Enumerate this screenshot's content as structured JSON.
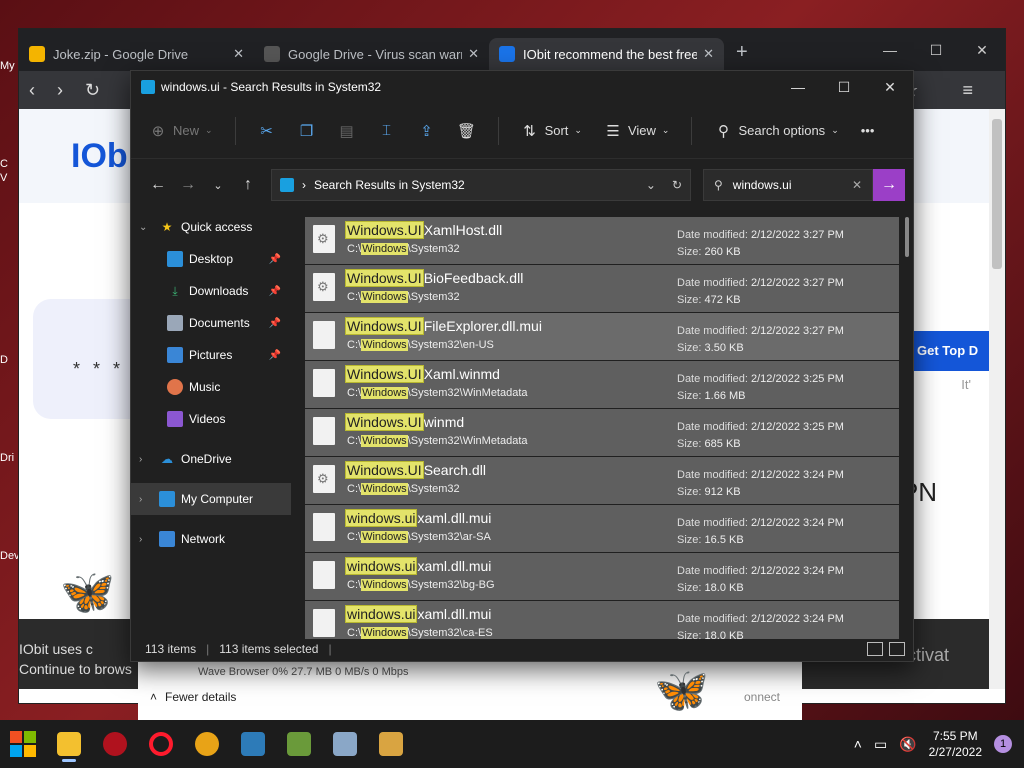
{
  "desktop": {
    "icon_labels": [
      "My",
      "C",
      "V",
      "D",
      "Dri",
      "Dev"
    ]
  },
  "browser": {
    "tabs": [
      {
        "label": "Joke.zip - Google Drive",
        "color": "#f4b400"
      },
      {
        "label": "Google Drive - Virus scan warn",
        "color": "#555555"
      },
      {
        "label": "IObit recommend the best free",
        "color": "#1a73e8"
      }
    ],
    "new_tab": "+",
    "page": {
      "logo": "IObit",
      "cta": "Get Top D",
      "its": "It'",
      "pn": "PN",
      "password_mask": "* * *",
      "cookie_line1": "IObit uses c",
      "cookie_line2": "Continue to brows",
      "watermark": "e activat"
    }
  },
  "taskmgr": {
    "row_text": "Wave Browser       0%     27.7 MB     0 MB/s     0 Mbps",
    "fewer_details": "Fewer details",
    "connect": "onnect"
  },
  "explorer": {
    "title": "windows.ui - Search Results in System32",
    "commands": {
      "new": "New",
      "sort": "Sort",
      "view": "View",
      "search_options": "Search options",
      "more": "•••"
    },
    "address": "Search Results in System32",
    "search_value": "windows.ui",
    "nav": {
      "quick_access": "Quick access",
      "desktop": "Desktop",
      "downloads": "Downloads",
      "documents": "Documents",
      "pictures": "Pictures",
      "music": "Music",
      "videos": "Videos",
      "onedrive": "OneDrive",
      "my_computer": "My Computer",
      "network": "Network"
    },
    "results": [
      {
        "match": "Windows.UI",
        "rest": "XamlHost.dll",
        "path_pre": "C:\\",
        "path_match": "Windows",
        "path_rest": "\\System32",
        "date": "2/12/2022 3:27 PM",
        "size": "260 KB",
        "gear": true
      },
      {
        "match": "Windows.UI",
        "rest": "BioFeedback.dll",
        "path_pre": "C:\\",
        "path_match": "Windows",
        "path_rest": "\\System32",
        "date": "2/12/2022 3:27 PM",
        "size": "472 KB",
        "gear": true
      },
      {
        "match": "Windows.UI",
        "rest": "FileExplorer.dll.mui",
        "path_pre": "C:\\",
        "path_match": "Windows",
        "path_rest": "\\System32\\en-US",
        "date": "2/12/2022 3:27 PM",
        "size": "3.50 KB",
        "gear": false
      },
      {
        "match": "Windows.UI",
        "rest": "Xaml.winmd",
        "path_pre": "C:\\",
        "path_match": "Windows",
        "path_rest": "\\System32\\WinMetadata",
        "date": "2/12/2022 3:25 PM",
        "size": "1.66 MB",
        "gear": false
      },
      {
        "match": "Windows.UI",
        "rest": "winmd",
        "path_pre": "C:\\",
        "path_match": "Windows",
        "path_rest": "\\System32\\WinMetadata",
        "date": "2/12/2022 3:25 PM",
        "size": "685 KB",
        "gear": false
      },
      {
        "match": "Windows.UI",
        "rest": "Search.dll",
        "path_pre": "C:\\",
        "path_match": "Windows",
        "path_rest": "\\System32",
        "date": "2/12/2022 3:24 PM",
        "size": "912 KB",
        "gear": true
      },
      {
        "match": "windows.ui",
        "rest": "xaml.dll.mui",
        "path_pre": "C:\\",
        "path_match": "Windows",
        "path_rest": "\\System32\\ar-SA",
        "date": "2/12/2022 3:24 PM",
        "size": "16.5 KB",
        "gear": false
      },
      {
        "match": "windows.ui",
        "rest": "xaml.dll.mui",
        "path_pre": "C:\\",
        "path_match": "Windows",
        "path_rest": "\\System32\\bg-BG",
        "date": "2/12/2022 3:24 PM",
        "size": "18.0 KB",
        "gear": false
      },
      {
        "match": "windows.ui",
        "rest": "xaml.dll.mui",
        "path_pre": "C:\\",
        "path_match": "Windows",
        "path_rest": "\\System32\\ca-ES",
        "date": "2/12/2022 3:24 PM",
        "size": "18.0 KB",
        "gear": false
      }
    ],
    "date_label": "Date modified:",
    "size_label": "Size:",
    "status": {
      "count": "113 items",
      "selected": "113 items selected"
    }
  },
  "taskbar": {
    "time": "7:55 PM",
    "date": "2/27/2022",
    "notifications": "1"
  }
}
